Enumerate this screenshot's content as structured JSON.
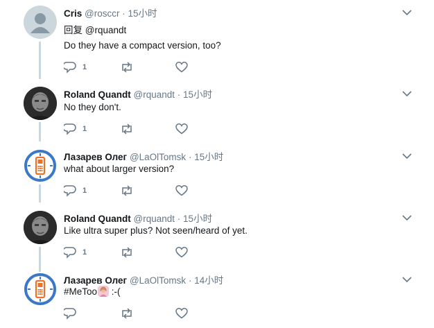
{
  "tweets": [
    {
      "name": "Cris",
      "handle": "@rosccr",
      "dot": "·",
      "time": "15小时",
      "reply_prefix": "回复",
      "reply_to": "@rquandt",
      "text": "Do they have a compact version, too?",
      "reply_count": "1",
      "avatar": "default-avatar-icon"
    },
    {
      "name": "Roland Quandt",
      "handle": "@rquandt",
      "dot": "·",
      "time": "15小时",
      "text": "No they don't.",
      "reply_count": "1",
      "avatar": "roland-photo-avatar"
    },
    {
      "name": "Лазарев Олег",
      "handle": "@LaOlTomsk",
      "dot": "·",
      "time": "15小时",
      "text": "what about larger version?",
      "reply_count": "1",
      "avatar": "phone-logo-avatar"
    },
    {
      "name": "Roland Quandt",
      "handle": "@rquandt",
      "dot": "·",
      "time": "15小时",
      "text": "Like ultra super plus? Not seen/heard of yet.",
      "reply_count": "1",
      "avatar": "roland-photo-avatar"
    },
    {
      "name": "Лазарев Олег",
      "handle": "@LaOlTomsk",
      "dot": "·",
      "time": "14小时",
      "text": "#MeToo",
      "text_suffix": ":-(",
      "reply_count": "",
      "avatar": "phone-logo-avatar"
    }
  ],
  "colors": {
    "text": "#14171a",
    "secondary": "#657786",
    "thread_line": "#ccd6dd",
    "logo_blue": "#3b78c6",
    "logo_orange": "#e8742b"
  }
}
